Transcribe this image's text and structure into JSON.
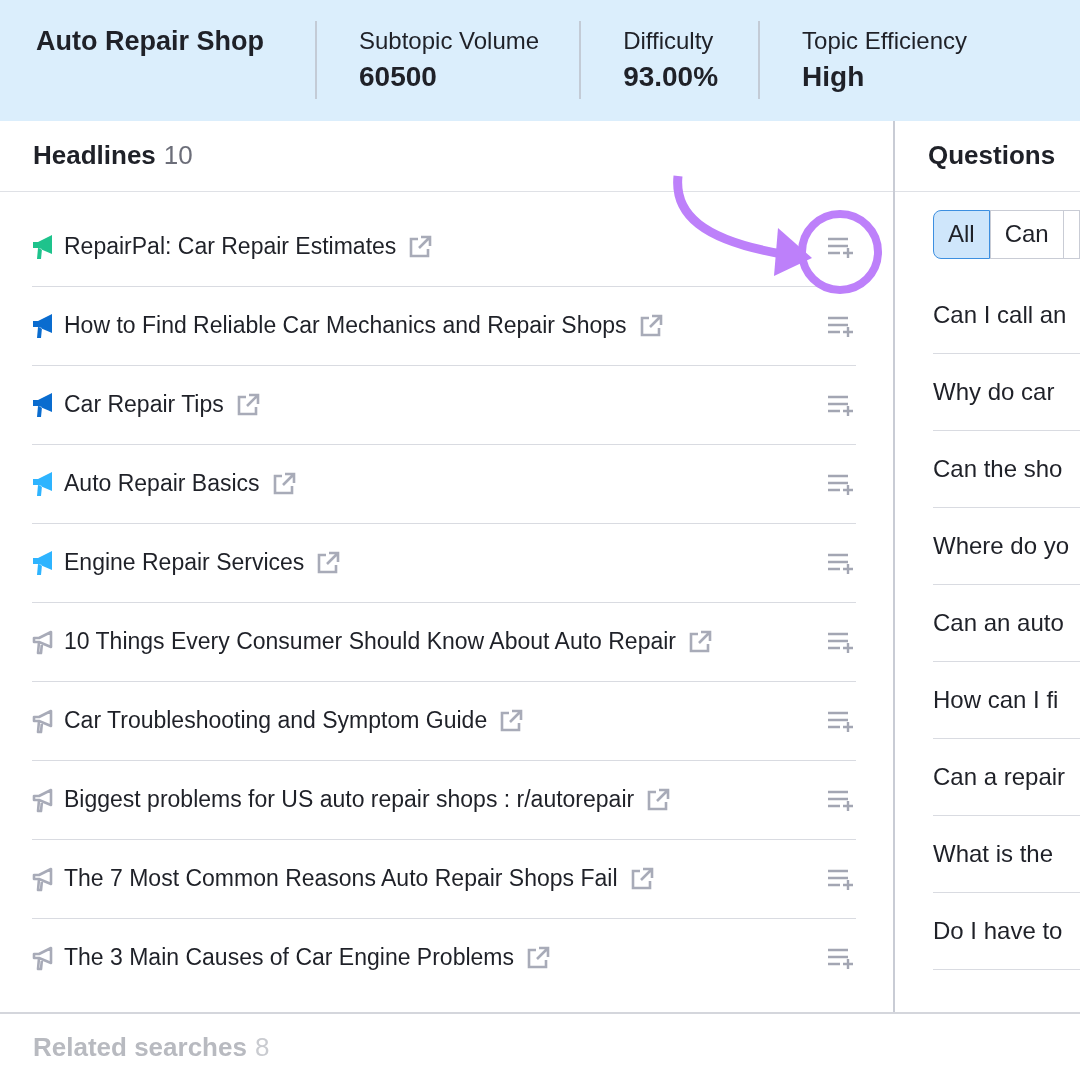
{
  "summary": {
    "title": "Auto Repair Shop",
    "metrics": [
      {
        "label": "Subtopic Volume",
        "value": "60500"
      },
      {
        "label": "Difficulty",
        "value": "93.00%"
      },
      {
        "label": "Topic Efficiency",
        "value": "High"
      }
    ]
  },
  "headlines": {
    "title": "Headlines",
    "count": "10",
    "items": [
      {
        "text": "RepairPal: Car Repair Estimates",
        "kind": "filled",
        "color": "#1ec38c",
        "highlighted": true
      },
      {
        "text": "How to Find Reliable Car Mechanics and Repair Shops",
        "kind": "filled",
        "color": "#0a6ccf",
        "highlighted": false
      },
      {
        "text": "Car Repair Tips",
        "kind": "filled",
        "color": "#0a6ccf",
        "highlighted": false
      },
      {
        "text": "Auto Repair Basics",
        "kind": "filled",
        "color": "#2eb4ff",
        "highlighted": false
      },
      {
        "text": "Engine Repair Services",
        "kind": "filled",
        "color": "#2eb4ff",
        "highlighted": false
      },
      {
        "text": "10 Things Every Consumer Should Know About Auto Repair",
        "kind": "outline",
        "color": "#a8abb8",
        "highlighted": false
      },
      {
        "text": "Car Troubleshooting and Symptom Guide",
        "kind": "outline",
        "color": "#a8abb8",
        "highlighted": false
      },
      {
        "text": "Biggest problems for US auto repair shops : r/autorepair",
        "kind": "outline",
        "color": "#a8abb8",
        "highlighted": false
      },
      {
        "text": "The 7 Most Common Reasons Auto Repair Shops Fail",
        "kind": "outline",
        "color": "#a8abb8",
        "highlighted": false
      },
      {
        "text": "The 3 Main Causes of Car Engine Problems",
        "kind": "outline",
        "color": "#a8abb8",
        "highlighted": false
      }
    ]
  },
  "questions": {
    "title": "Questions",
    "filters": [
      {
        "label": "All",
        "selected": true
      },
      {
        "label": "Can",
        "selected": false
      }
    ],
    "items": [
      "Can I call an",
      "Why do car",
      "Can the sho",
      "Where do yo",
      "Can an auto",
      "How can I fi",
      "Can a repair",
      "What is the",
      "Do I have to"
    ]
  },
  "related": {
    "title": "Related searches",
    "count": "8"
  }
}
